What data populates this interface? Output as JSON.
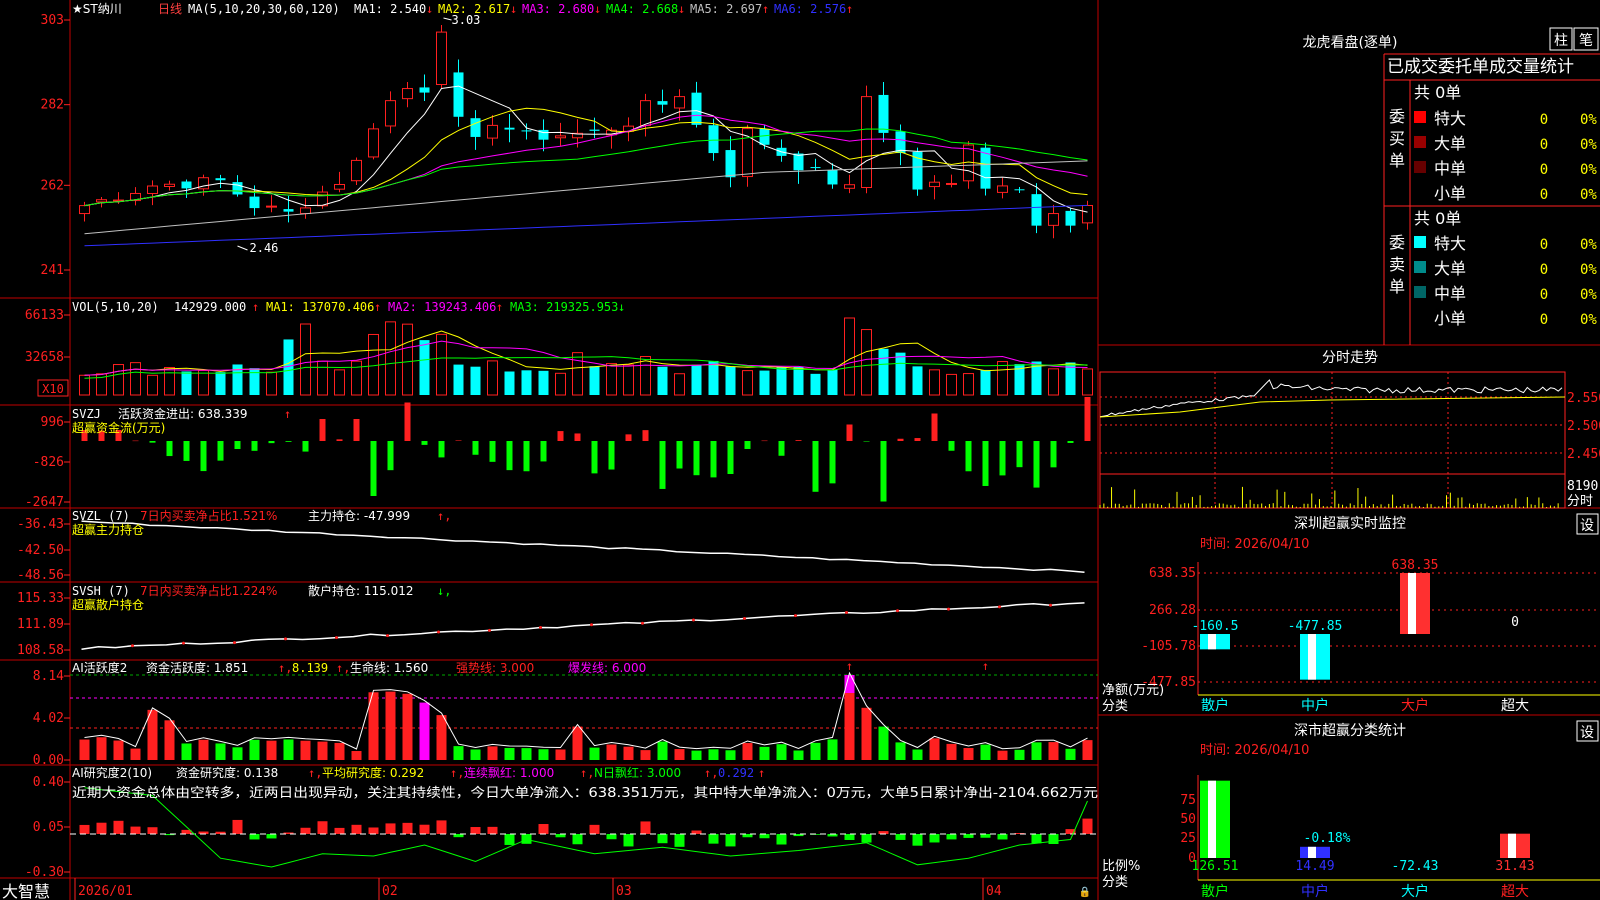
{
  "app": {
    "brand": "大智慧",
    "date_axis": [
      "2026/01",
      "02",
      "03",
      "04"
    ]
  },
  "main_chart": {
    "title": "★ST纳川",
    "period": "日线",
    "ma_header": "MA(5,10,20,30,60,120)",
    "ma_values": [
      {
        "label": "MA1: 2.540",
        "arrow": "↓",
        "color": "#ffffff"
      },
      {
        "label": "MA2: 2.617",
        "arrow": "↓",
        "color": "#ffff00"
      },
      {
        "label": "MA3: 2.680",
        "arrow": "↓",
        "color": "#ff00ff"
      },
      {
        "label": "MA4: 2.668",
        "arrow": "↓",
        "color": "#00ff00"
      },
      {
        "label": "MA5: 2.697",
        "arrow": "↑",
        "color": "#c0c0c0"
      },
      {
        "label": "MA6: 2.576",
        "arrow": "↑",
        "color": "#3030ff"
      }
    ],
    "y_ticks": [
      "303",
      "282",
      "262",
      "241"
    ],
    "high_label": "3.03",
    "low_label": "2.46"
  },
  "vol_panel": {
    "header": "VOL(5,10,20)",
    "value": "142929.000",
    "ma": [
      {
        "label": "MA1: 137070.406",
        "arrow": "↑",
        "color": "#ffff00"
      },
      {
        "label": "MA2: 139243.406",
        "arrow": "↑",
        "color": "#ff00ff"
      },
      {
        "label": "MA3: 219325.953",
        "arrow": "↓",
        "color": "#00ff00"
      }
    ],
    "y_ticks": [
      "66133",
      "32658"
    ],
    "unit": "X10"
  },
  "svzj_panel": {
    "header": "SVZJ",
    "line1": "活跃资金进出: 638.339",
    "line2": "超赢资金流(万元)",
    "y_ticks": [
      "996",
      "-826",
      "-2647"
    ]
  },
  "svzl_panel": {
    "header": "SVZL (7)",
    "ratio": "7日内买卖净占比1.521%",
    "hold": "主力持仓: -47.999",
    "line2": "超赢主力持仓",
    "y_ticks": [
      "-36.43",
      "-42.50",
      "-48.56"
    ]
  },
  "svsh_panel": {
    "header": "SVSH (7)",
    "ratio": "7日内买卖净占比1.224%",
    "hold": "散户持仓: 115.012",
    "line2": "超赢散户持仓",
    "y_ticks": [
      "115.33",
      "111.89",
      "108.58"
    ]
  },
  "ai_active_panel": {
    "header": "AI活跃度2",
    "a": "资金活跃度: 1.851",
    "b": "8.139",
    "c": "生命线: 1.560",
    "d": "强势线: 3.000",
    "e": "爆发线: 6.000",
    "y_ticks": [
      "8.14",
      "4.02",
      "0.00"
    ]
  },
  "ai_research_panel": {
    "header": "AI研究度2(10)",
    "a": "资金研究度: 0.138",
    "b": "平均研究度: 0.292",
    "c": "连续飘红: 1.000",
    "d": "N日飘红: 3.000",
    "e": "0.292",
    "comment": "近期大资金总体由空转多，近两日出现异动，关注其持续性，今日大单净流入：638.351万元，其中特大单净流入：0万元，大单5日累计净出-2104.662万元",
    "y_ticks": [
      "0.40",
      "0.05",
      "-0.30"
    ]
  },
  "dragon_tiger": {
    "title": "龙虎看盘(逐单)",
    "tab_bar": "柱",
    "tab_order": "笔",
    "subtitle": "已成交委托单成交量统计",
    "buy_label": "委买单",
    "sell_label": "委卖单",
    "buy_total": "共 0单",
    "sell_total": "共 0单",
    "buy_rows": [
      {
        "name": "特大",
        "count": "0",
        "pct": "0%",
        "color": "#ff0000"
      },
      {
        "name": "大单",
        "count": "0",
        "pct": "0%",
        "color": "#990000"
      },
      {
        "name": "中单",
        "count": "0",
        "pct": "0%",
        "color": "#660000"
      },
      {
        "name": "小单",
        "count": "0",
        "pct": "0%",
        "color": "#000000"
      }
    ],
    "sell_rows": [
      {
        "name": "特大",
        "count": "0",
        "pct": "0%",
        "color": "#00ffff"
      },
      {
        "name": "大单",
        "count": "0",
        "pct": "0%",
        "color": "#008b8b"
      },
      {
        "name": "中单",
        "count": "0",
        "pct": "0%",
        "color": "#006666"
      },
      {
        "name": "小单",
        "count": "0",
        "pct": "0%",
        "color": "#000000"
      }
    ]
  },
  "intraday": {
    "title": "分时走势",
    "y_ticks": [
      "2.550",
      "2.500",
      "2.450"
    ],
    "vol_tick": "8190",
    "vol_unit": "分时"
  },
  "sz_monitor": {
    "title": "深圳超赢实时监控",
    "settings": "设",
    "time": "时间: 2026/04/10",
    "y_ticks": [
      "638.35",
      "266.28",
      "-105.78",
      "-477.85"
    ],
    "y_label": "净额(万元)",
    "x_label": "分类",
    "bars": [
      {
        "cat": "散户",
        "value": -160.5,
        "label": "-160.5",
        "color": "#00ffff"
      },
      {
        "cat": "中户",
        "value": -477.85,
        "label": "-477.85",
        "color": "#00ffff"
      },
      {
        "cat": "大户",
        "value": 638.35,
        "label": "638.35",
        "color": "#ff3030"
      },
      {
        "cat": "超大",
        "value": 0,
        "label": "0",
        "color": "#ffffff"
      }
    ]
  },
  "sz_category": {
    "title": "深市超赢分类统计",
    "settings": "设",
    "time": "时间: 2026/04/10",
    "y_ticks": [
      "75",
      "50",
      "25",
      "0"
    ],
    "y_label": "比例%",
    "x_label": "分类",
    "bars": [
      {
        "cat": "散户",
        "value": 126.51,
        "label": "126.51",
        "color": "#00ff00"
      },
      {
        "cat": "中户",
        "value": 14.49,
        "label": "14.49",
        "extra": "-0.18%",
        "color": "#3030ff"
      },
      {
        "cat": "大户",
        "value": -72.43,
        "label": "-72.43",
        "color": "#00ffff"
      },
      {
        "cat": "超大",
        "value": 31.43,
        "label": "31.43",
        "color": "#ff3030"
      }
    ]
  },
  "colors": {
    "up": "#ff2020",
    "down": "#00ffff",
    "grid": "#c00000",
    "axis": "#ff4040"
  }
}
